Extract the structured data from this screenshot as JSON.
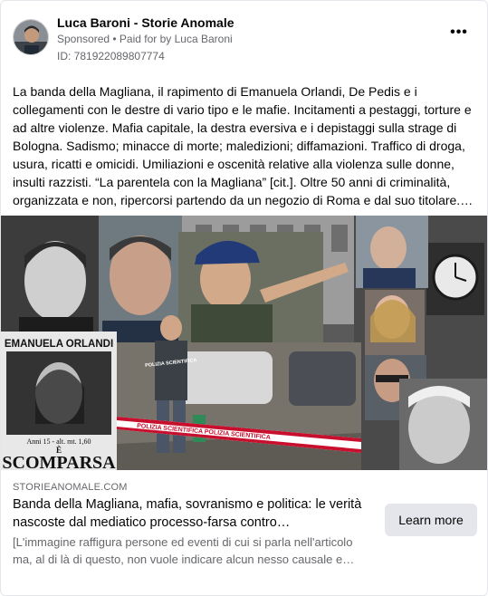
{
  "post": {
    "page_name": "Luca Baroni - Storie Anomale",
    "sponsored_label": "Sponsored",
    "separator": " • ",
    "paid_prefix": "Paid for by ",
    "paid_by": "Luca Baroni",
    "ad_id": "ID: 781922089807774",
    "more_icon": "more-horizontal-icon",
    "more_glyph": "•••",
    "body_text": "La banda della Magliana, il rapimento di Emanuela Orlandi, De Pedis e i collegamenti con le destre di vario tipo e le mafie. Incitamenti a pestaggi, torture e ad altre violenze. Mafia capitale, la destra eversiva e i depistaggi sulla strage di Bologna. Sadismo; minacce di morte; maledizioni; diffamazioni. Traffico di droga, usura, ricatti e omicidi. Umiliazioni e oscenità relative alla violenza sulle donne, insulti razzisti. “La parentela con la Magliana” [cit.]. Oltre 50 anni di criminalità, organizzata e non, ripercorsi partendo da un negozio di Roma e dal suo titolare.…"
  },
  "creative": {
    "poster_name": "EMANUELA ORLANDI",
    "poster_age": "Anni 15 - alt. mt. 1,60",
    "poster_e": "È",
    "poster_missing": "SCOMPARSA",
    "police_vest": "POLIZIA SCIENTIFICA",
    "tape_text": "POLIZIA SCIENTIFICA  POLIZIA SCIENTIFICA"
  },
  "link": {
    "domain": "STORIEANOMALE.COM",
    "headline": "Banda della Magliana, mafia, sovranismo e politica: le verità nascoste dal mediatico processo-farsa contro…",
    "description": "[L'immagine raffigura persone ed eventi di cui si parla nell'articolo ma, al di là di questo, non vuole indicare alcun nesso causale e…",
    "cta_label": "Learn more"
  },
  "colors": {
    "text_primary": "#050505",
    "text_secondary": "#65676b",
    "button_bg": "#e4e6eb",
    "tape_red": "#c8102e"
  }
}
